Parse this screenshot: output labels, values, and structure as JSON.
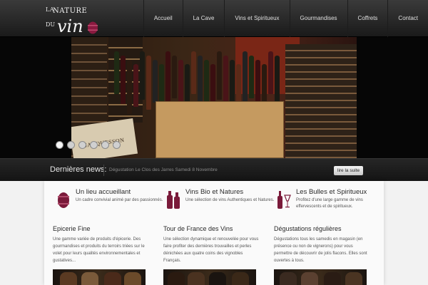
{
  "logo": {
    "line1": "LA",
    "line2": "NATURE",
    "line3": "DU",
    "line4": "vin"
  },
  "nav": {
    "items": [
      "Accueil",
      "La Cave",
      "Vins et Spiritueux",
      "Gourmandises",
      "Coffrets",
      "Contact"
    ]
  },
  "slider": {
    "crate_label": "JACQUESSON",
    "dot_count": 6,
    "active_dot": 1
  },
  "news": {
    "title": "Dernières news:",
    "text": "Dégustation Le Clos des Jarres Samedi 8 Novembre",
    "button": "lire la suite"
  },
  "features": [
    {
      "icon": "barrel-icon",
      "title": "Un lieu accueillant",
      "desc": "Un cadre convivial animé par des passionnés."
    },
    {
      "icon": "wine-bottles-icon",
      "title": "Vins Bio et Natures",
      "desc": "Une sélection de vins Authentiques et Natures."
    },
    {
      "icon": "bottle-glass-icon",
      "title": "Les Bulles et Spiritueux",
      "desc": "Profitez d'une large gamme de vins effervescents et de spiritueux."
    }
  ],
  "columns": [
    {
      "title": "Epicerie Fine",
      "desc": "Une gamme variée de produits d'épicerie. Des gourmandises et produits du terroirs triées sur le volet pour leurs qualités environnementales et gustatives..."
    },
    {
      "title": "Tour de France des Vins",
      "desc": "Une sélection dynamique et renouvelée pour vous faire profiter des dernières trouvailles et perles dénichées aux quatre coins des vignobles Français."
    },
    {
      "title": "Dégustations régulières",
      "desc": "Dégustations tous les samedis en magasin (en présence ou non de vignerons) pour vous permettre de découvrir de jolis flacons. Elles sont ouvertes à tous."
    }
  ],
  "colors": {
    "accent": "#7a1a3a",
    "header": "#2a2a2a",
    "content_bg": "#fafafa"
  }
}
